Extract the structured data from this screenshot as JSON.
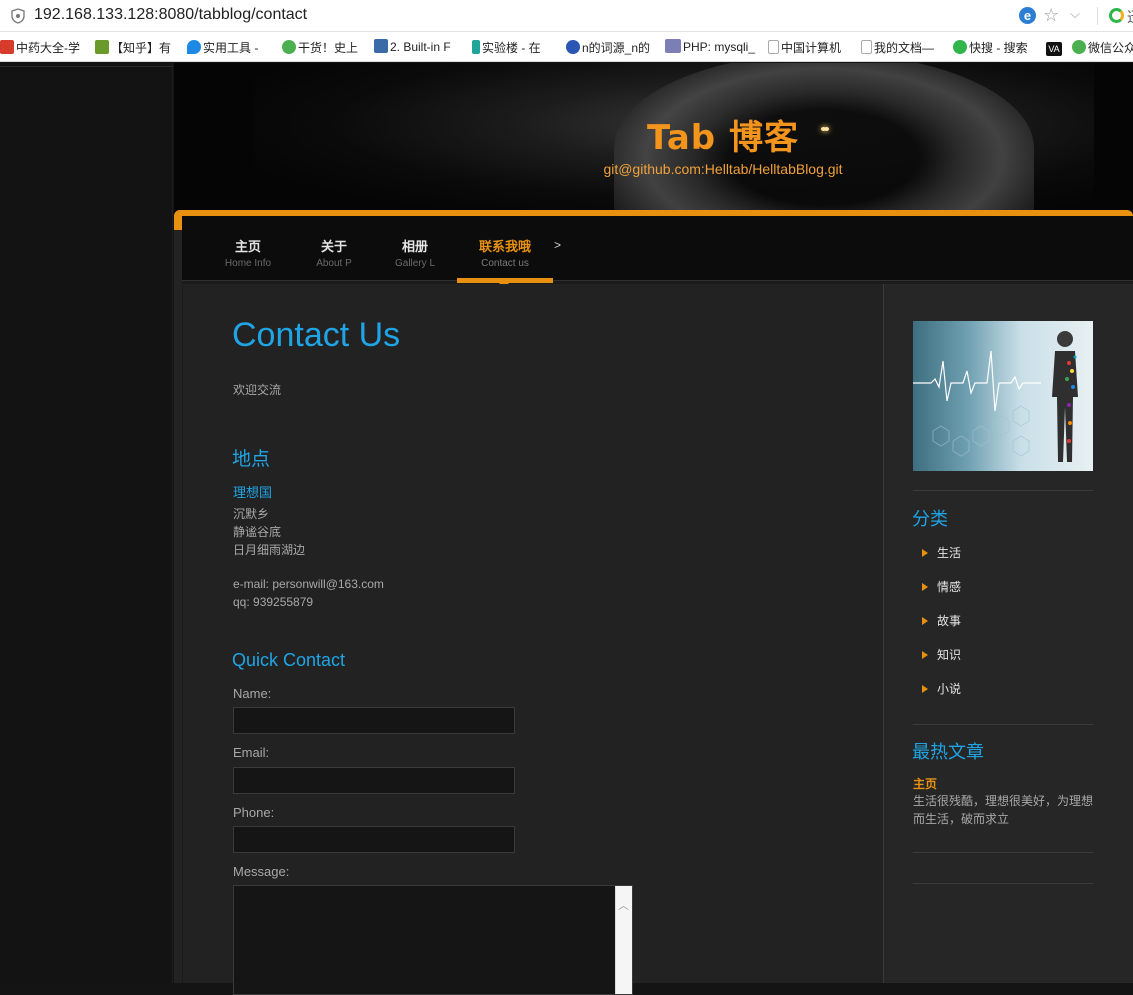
{
  "browser": {
    "url": "192.168.133.128:8080/tabblog/contact",
    "ie_icon_label": "e",
    "cut_text": "迅",
    "bookmarks": [
      {
        "label": "中药大全-学",
        "color": "#d63b2b"
      },
      {
        "label": "【知乎】有",
        "color": "#6a9a2a"
      },
      {
        "label": "实用工具 -",
        "color": "#1e88e5"
      },
      {
        "label": "干货！史上",
        "color": "#4caf50"
      },
      {
        "label": "2. Built-in F",
        "color": "#3a6aa8"
      },
      {
        "label": "实验楼 - 在",
        "color": "#1fa59a"
      },
      {
        "label": "n的词源_n的",
        "color": "#2b56b4"
      },
      {
        "label": "PHP: mysqli_",
        "color": "#7b7fb5"
      },
      {
        "label": "中国计算机",
        "color": "#bbbbbb"
      },
      {
        "label": "我的文档—",
        "color": "#bbbbbb"
      },
      {
        "label": "快搜 - 搜索",
        "color": "#2fb54a"
      },
      {
        "label": "VA",
        "color": "#111111"
      },
      {
        "label": "微信公众",
        "color": "#4caf50"
      }
    ]
  },
  "header": {
    "title": "Tab 博客",
    "subtitle": "git@github.com:Helltab/HelltabBlog.git"
  },
  "nav": {
    "items": [
      {
        "zh": "主页",
        "en": "Home Info"
      },
      {
        "zh": "关于",
        "en": "About P"
      },
      {
        "zh": "相册",
        "en": "Gallery L"
      },
      {
        "zh": "联系我哦",
        "en": "Contact us"
      }
    ],
    "more": ">"
  },
  "contact": {
    "title": "Contact Us",
    "welcome": "欢迎交流",
    "location_heading": "地点",
    "place_name": "理想国",
    "address": [
      "沉默乡",
      "静谧谷底",
      "日月细雨湖边"
    ],
    "email": "e-mail: personwill@163.com",
    "qq": "qq: 939255879",
    "quick_heading": "Quick Contact",
    "labels": {
      "name": "Name:",
      "email": "Email:",
      "phone": "Phone:",
      "message": "Message:"
    },
    "values": {
      "name": "",
      "email": "",
      "phone": "",
      "message": ""
    }
  },
  "sidebar": {
    "category_heading": "分类",
    "categories": [
      "生活",
      "情感",
      "故事",
      "知识",
      "小说"
    ],
    "hot_heading": "最热文章",
    "hot_post": {
      "title": "主页",
      "desc": "生活很残酷，理想很美好，为理想而生活，破而求立"
    }
  },
  "colors": {
    "accent": "#e8900f",
    "link_blue": "#1fa5e6"
  }
}
